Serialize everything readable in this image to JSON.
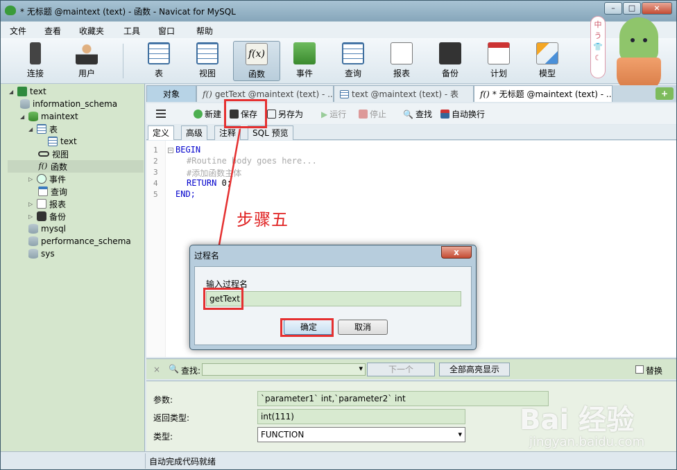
{
  "window": {
    "title": "* 无标题 @maintext (text) - 函数 - Navicat for MySQL"
  },
  "menu": [
    "文件",
    "查看",
    "收藏夹",
    "工具",
    "窗口",
    "帮助"
  ],
  "toolbar": {
    "connect": "连接",
    "user": "用户",
    "table": "表",
    "view": "视图",
    "function": "函数",
    "event": "事件",
    "query": "查询",
    "report": "报表",
    "backup": "备份",
    "schedule": "计划",
    "model": "模型"
  },
  "mascot": {
    "tag": "中\nう\n👕\n☾"
  },
  "sidebar": {
    "items": [
      "text",
      "information_schema",
      "maintext",
      "表",
      "text",
      "视图",
      "函数",
      "事件",
      "查询",
      "报表",
      "备份",
      "mysql",
      "performance_schema",
      "sys"
    ]
  },
  "tabs": {
    "objects": "对象",
    "tab1": "getText @maintext (text) - ...",
    "tab2": "text @maintext (text) - 表",
    "tab3": "* 无标题 @maintext (text) - ..."
  },
  "editor_toolbar": {
    "new": "新建",
    "save": "保存",
    "save_as": "另存为",
    "run": "运行",
    "stop": "停止",
    "find": "查找",
    "auto_wrap": "自动换行"
  },
  "subtabs": [
    "定义",
    "高级",
    "注释",
    "SQL 预览"
  ],
  "code": {
    "lines": [
      "1",
      "2",
      "3",
      "4",
      "5"
    ],
    "l1": "BEGIN",
    "l2": "#Routine body goes here...",
    "l3": "#添加函数主体",
    "l4_kw": "RETURN",
    "l4_rest": " 0;",
    "l5": "END;"
  },
  "annotation": "步骤五",
  "dialog": {
    "title": "过程名",
    "close": "x",
    "label": "输入过程名",
    "value": "getText",
    "ok": "确定",
    "cancel": "取消"
  },
  "find": {
    "close": "×",
    "label": "查找:",
    "next": "下一个",
    "highlight_all": "全部高亮显示",
    "replace": "替换"
  },
  "properties": {
    "params_label": "参数:",
    "params_value": "`parameter1` int,`parameter2` int",
    "return_label": "返回类型:",
    "return_value": "int(111)",
    "type_label": "类型:",
    "type_value": "FUNCTION"
  },
  "status": "自动完成代码就绪",
  "watermark": {
    "brand": "Bai 经验",
    "url": "jingyan.baidu.com"
  },
  "colors": {
    "accent_red": "#e53030",
    "sidebar_bg": "#d5e6cd"
  }
}
